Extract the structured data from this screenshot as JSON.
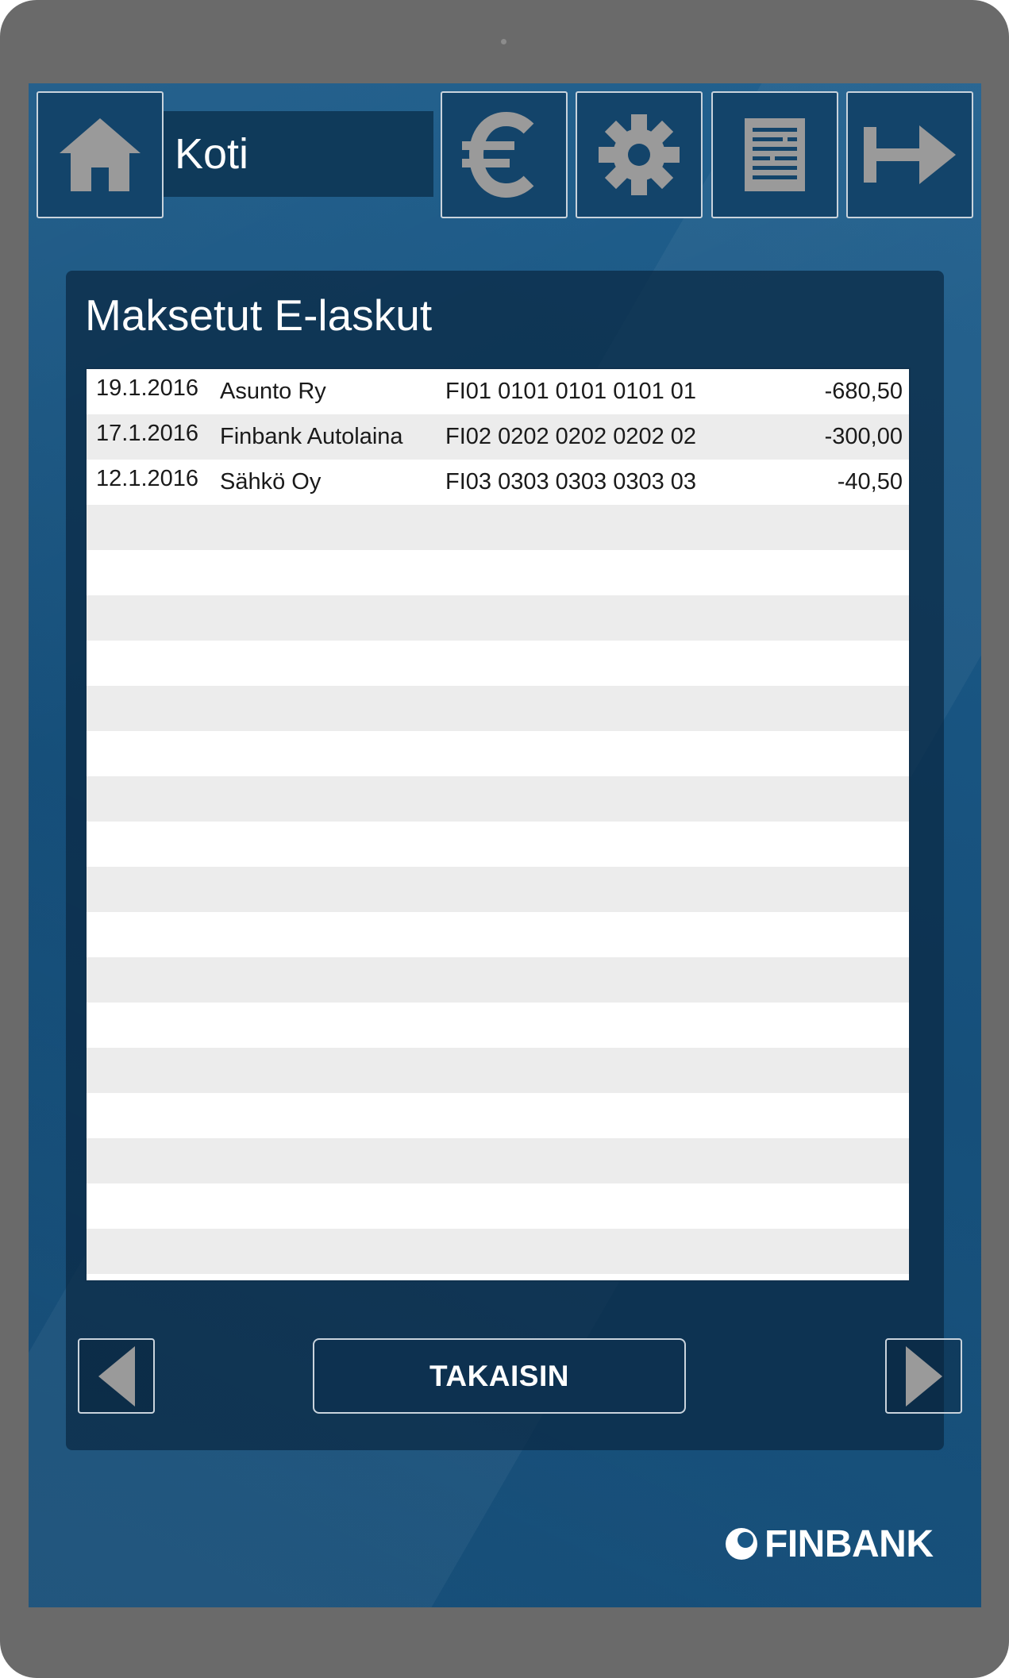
{
  "header": {
    "home_label": "Koti",
    "icons": [
      "home-icon",
      "euro-icon",
      "gear-icon",
      "document-icon",
      "logout-icon"
    ]
  },
  "page": {
    "title": "Maksetut E-laskut"
  },
  "invoices": [
    {
      "date": "19.1.2016",
      "payee": "Asunto Ry",
      "account": "FI01 0101 0101 0101 01",
      "amount": "-680,50"
    },
    {
      "date": "17.1.2016",
      "payee": "Finbank Autolaina",
      "account": "FI02 0202 0202 0202 02",
      "amount": "-300,00"
    },
    {
      "date": "12.1.2016",
      "payee": "Sähkö Oy",
      "account": "FI03 0303 0303 0303 03",
      "amount": "-40,50"
    }
  ],
  "footer": {
    "back_label": "TAKAISIN",
    "prev_icon": "triangle-left-icon",
    "next_icon": "triangle-right-icon"
  },
  "brand": {
    "logo_text": "FINBANK"
  },
  "colors": {
    "background": "#1a5785",
    "panel": "#0d3150",
    "icon_gray": "#9a9a9a",
    "row_alt": "#ececec"
  }
}
